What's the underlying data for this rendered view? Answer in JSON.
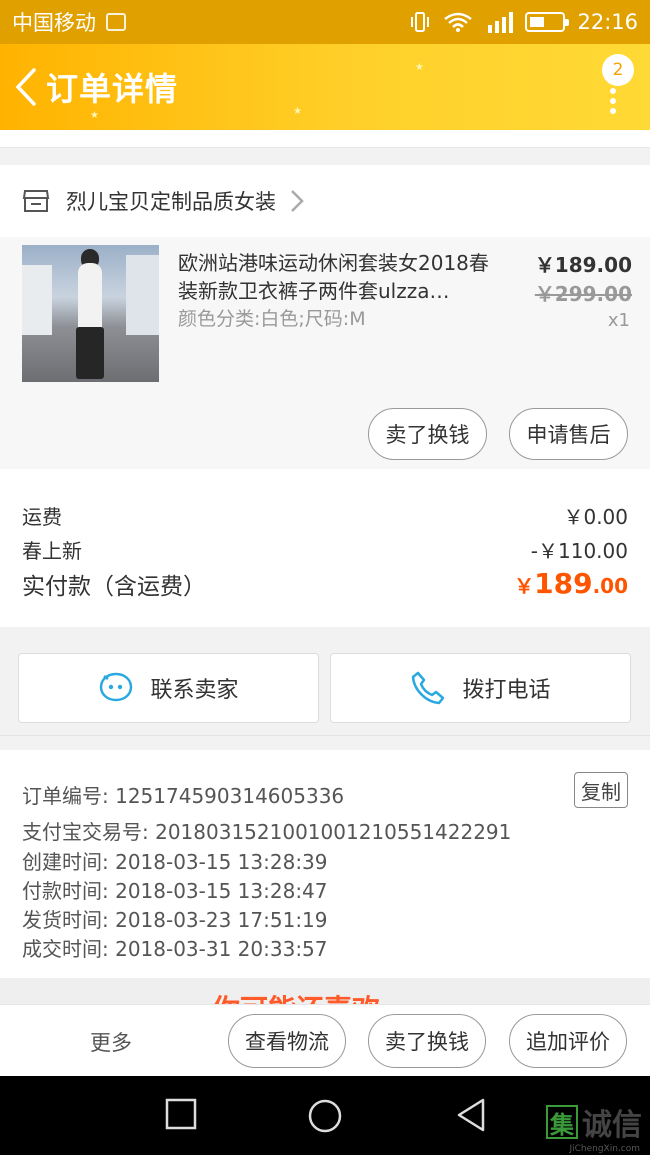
{
  "status_bar": {
    "carrier": "中国移动",
    "time": "22:16"
  },
  "header": {
    "title": "订单详情",
    "badge_count": "2"
  },
  "shop": {
    "name": "烈儿宝贝定制品质女装"
  },
  "product": {
    "title": "欧洲站港味运动休闲套装女2018春装新款卫衣裤子两件套ulzza…",
    "sku": "颜色分类:白色;尺码:M",
    "price": "￥189.00",
    "original_price": "￥299.00",
    "quantity": "x1",
    "actions": [
      "卖了换钱",
      "申请售后"
    ]
  },
  "fees": {
    "shipping_label": "运费",
    "shipping_value": "￥0.00",
    "promo_label": "春上新",
    "promo_value": "-￥110.00",
    "total_label": "实付款（含运费）",
    "total_currency": "￥",
    "total_main": "189",
    "total_decimal": ".00"
  },
  "contact": {
    "seller_label": "联系卖家",
    "phone_label": "拨打电话"
  },
  "order_info": {
    "order_no": "订单编号: 125174590314605336",
    "copy_label": "复制",
    "alipay_no": "支付宝交易号: 2018031521001001210551422291",
    "created": "创建时间: 2018-03-15 13:28:39",
    "paid": "付款时间: 2018-03-15 13:28:47",
    "shipped": "发货时间: 2018-03-23 17:51:19",
    "completed": "成交时间: 2018-03-31 20:33:57"
  },
  "recommend": {
    "peek_text": "你可能还喜欢"
  },
  "bottom_bar": {
    "more_label": "更多",
    "logistics_label": "查看物流",
    "resell_label": "卖了换钱",
    "review_label": "追加评价"
  },
  "watermark": {
    "box_char": "集",
    "text": "诚信",
    "sub": "JiChengXin.com"
  },
  "colors": {
    "header_start": "#ffb300",
    "header_end": "#ffd935",
    "accent_orange": "#ff5500",
    "contact_icon": "#2aa9e0"
  },
  "icons": [
    "back-arrow-icon",
    "more-dots-icon",
    "shop-icon",
    "chevron-right-icon",
    "chat-icon",
    "phone-icon",
    "nav-square-icon",
    "nav-circle-icon",
    "nav-triangle-icon",
    "wifi-icon",
    "signal-icon",
    "battery-icon",
    "vibrate-icon"
  ]
}
